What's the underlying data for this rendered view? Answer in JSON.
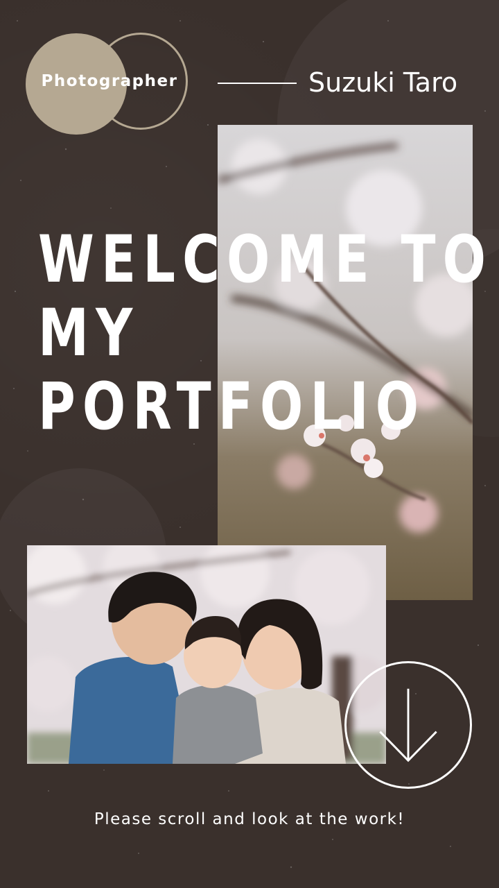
{
  "header": {
    "badge_label": "Photographer",
    "name": "Suzuki Taro"
  },
  "hero": {
    "headline_lines": [
      "WELCOME TO",
      "MY",
      "PORTFOLIO"
    ]
  },
  "images": {
    "blossom_photo": "cherry-blossom-branch-photo",
    "family_photo": "family-under-cherry-blossoms-photo"
  },
  "scroll_button": {
    "icon": "arrow-down-icon"
  },
  "footer": {
    "message": "Please scroll and look at the work!"
  },
  "colors": {
    "background": "#3a302c",
    "accent_beige": "#b5a892",
    "text": "#ffffff"
  }
}
